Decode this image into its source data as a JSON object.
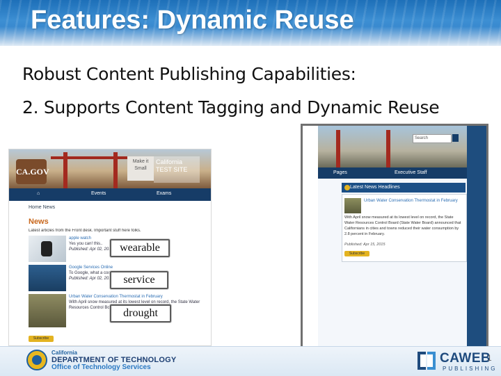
{
  "slide": {
    "title": "Features: Dynamic Reuse",
    "line1": "Robust Content Publishing Capabilities:",
    "line2": "2. Supports Content Tagging and Dynamic Reuse",
    "page_number": "1"
  },
  "left_screenshot": {
    "logo": "CA.GOV",
    "box_text": "Make it Small",
    "site_name": "California TEST SITE",
    "nav": [
      "Events",
      "Exams"
    ],
    "breadcrumb": "Home   News",
    "heading": "News",
    "intro": "Latest articles from the Front desk. Important stuff here folks.",
    "items": [
      {
        "title": "apple watch",
        "text": "Yes you can! this..",
        "published": "Published: Apr 02, 201"
      },
      {
        "title": "Google Services Online",
        "text": "To Google, what a cool",
        "published": "Published: Apr 02, 201"
      },
      {
        "title": "Urban Water Conservation Thermostat in February",
        "text": "With April snow measured at its lowest level on record, the State Water Resources Control Board...",
        "published": ""
      }
    ],
    "button": "Subscribe"
  },
  "tags": [
    "wearable",
    "service",
    "drought"
  ],
  "right_screenshot": {
    "search_placeholder": "Search",
    "nav": [
      "Pages",
      "Executive Staff"
    ],
    "hero": "Latest News Headlines",
    "card_title": "Urban Water Conservation Thermostat in February",
    "card_text": "With April snow measured at its lowest level on record, the State Water Resources Control Board (State Water Board) announced that Californians in cities and towns reduced their water consumption by 2.8 percent in February.",
    "published": "Published: Apr 15, 2015",
    "button": "Subscribe"
  },
  "footer": {
    "dept_line1": "California",
    "dept_line2": "DEPARTMENT OF TECHNOLOGY",
    "dept_line3": "Office of Technology Services",
    "brand": "CAWEB",
    "brand_sub": "PUBLISHING"
  }
}
